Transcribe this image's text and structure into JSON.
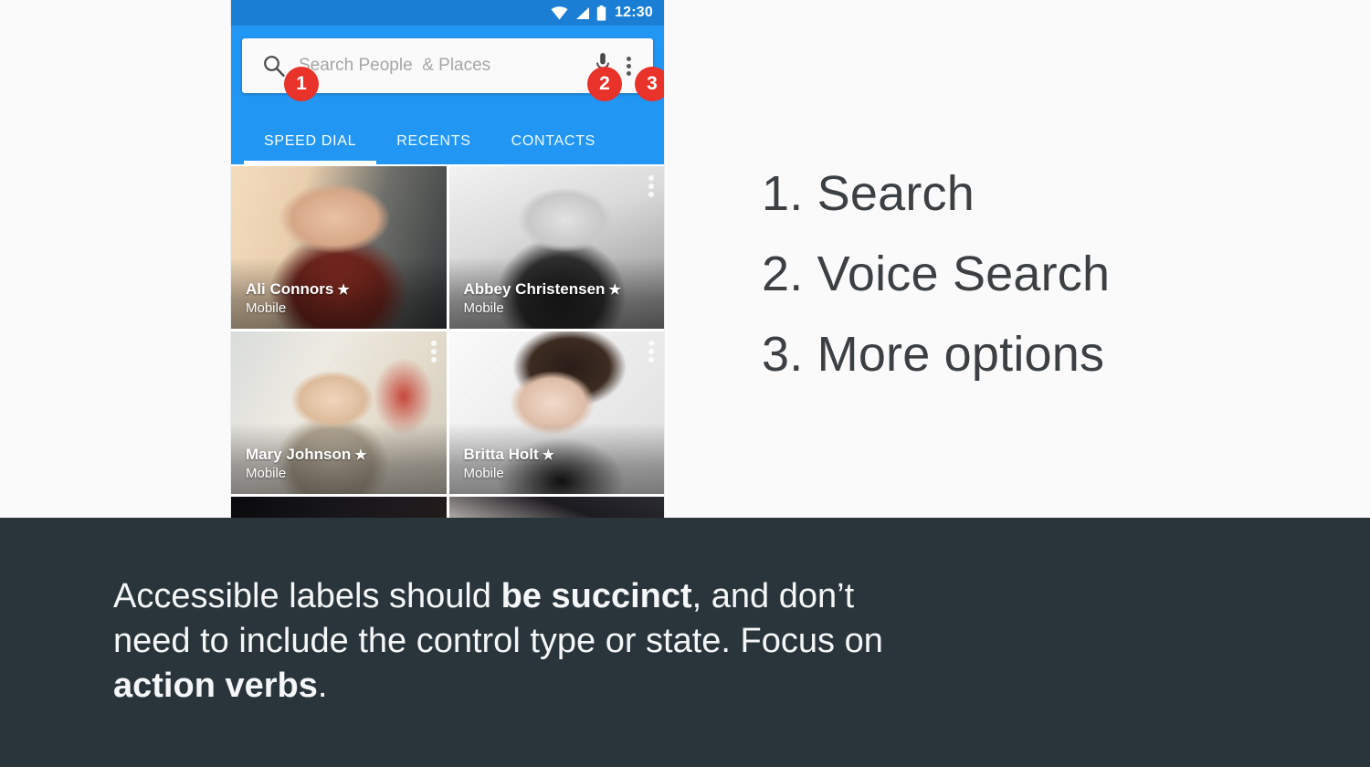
{
  "colors": {
    "status_bar_blue": "#1A7FD4",
    "app_bar_blue": "#2196F3",
    "badge_red": "#E8322A",
    "footer_dark": "#29353B",
    "page_background": "#FAFAFA",
    "legend_text": "#3C4043"
  },
  "phone": {
    "status_bar": {
      "time": "12:30",
      "icons": [
        "wifi-icon",
        "cellular-signal-icon",
        "battery-icon"
      ]
    },
    "search": {
      "placeholder": "Search People  & Places",
      "search_icon": "search-icon",
      "voice_icon": "microphone-icon",
      "overflow_icon": "more-vert-icon"
    },
    "badges": [
      {
        "id": "1",
        "label": "1",
        "target": "search-icon"
      },
      {
        "id": "2",
        "label": "2",
        "target": "microphone-icon"
      },
      {
        "id": "3",
        "label": "3",
        "target": "more-vert-icon"
      }
    ],
    "tabs": [
      {
        "label": "SPEED DIAL",
        "active": true
      },
      {
        "label": "RECENTS",
        "active": false
      },
      {
        "label": "CONTACTS",
        "active": false
      }
    ],
    "contacts": [
      {
        "name": "Ali Connors",
        "star": "★",
        "subtitle": "Mobile",
        "overflow": false
      },
      {
        "name": "Abbey Christensen",
        "star": "★",
        "subtitle": "Mobile",
        "overflow": true
      },
      {
        "name": "Mary Johnson",
        "star": "★",
        "subtitle": "Mobile",
        "overflow": true
      },
      {
        "name": "Britta Holt",
        "star": "★",
        "subtitle": "Mobile",
        "overflow": true
      }
    ]
  },
  "legend": {
    "items": [
      "1. Search",
      "2. Voice Search",
      "3. More options"
    ]
  },
  "footer": {
    "caption_parts": {
      "p1": "Accessible labels should ",
      "b1": "be succinct",
      "p2": ", and don’t need to include the control type or state. Focus on ",
      "b2": "action verbs",
      "p3": "."
    }
  }
}
